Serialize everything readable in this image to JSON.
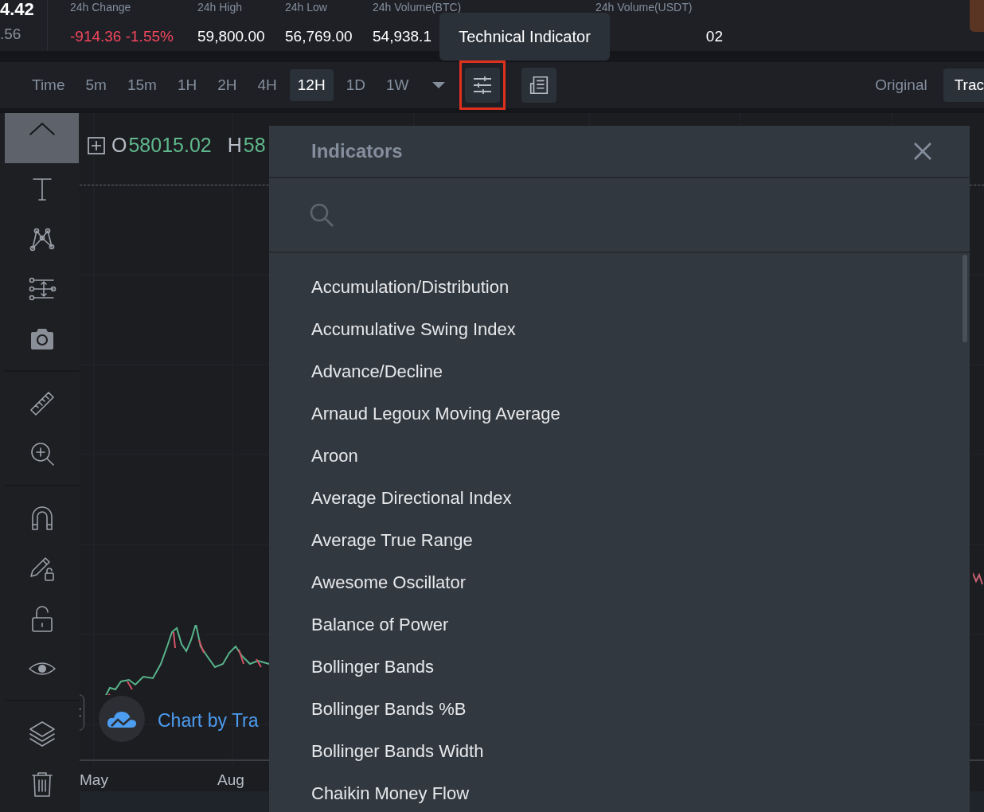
{
  "ticker": {
    "price": "4.42",
    "sub_price": ".56"
  },
  "stats": [
    {
      "label": "24h Change",
      "value": "-914.36 -1.55%",
      "color": "#f6465d"
    },
    {
      "label": "24h High",
      "value": "59,800.00",
      "color": "#ffffff"
    },
    {
      "label": "24h Low",
      "value": "56,769.00",
      "color": "#ffffff"
    },
    {
      "label": "24h Volume(BTC)",
      "value": "54,938.1",
      "color": "#ffffff"
    },
    {
      "label": "24h Volume(USDT)",
      "value": "02",
      "color": "#ffffff"
    }
  ],
  "tooltip": "Technical Indicator",
  "toolbar": {
    "intervals": [
      {
        "label": "Time",
        "selected": false
      },
      {
        "label": "5m",
        "selected": false
      },
      {
        "label": "15m",
        "selected": false
      },
      {
        "label": "1H",
        "selected": false
      },
      {
        "label": "2H",
        "selected": false
      },
      {
        "label": "4H",
        "selected": false
      },
      {
        "label": "12H",
        "selected": true
      },
      {
        "label": "1D",
        "selected": false
      },
      {
        "label": "1W",
        "selected": false
      }
    ],
    "tool_buttons": [
      {
        "kind": "indicators",
        "highlighted": true
      },
      {
        "kind": "template",
        "highlighted": false
      }
    ],
    "views": [
      {
        "label": "Original",
        "selected": false
      },
      {
        "label": "Trac",
        "selected": true
      }
    ]
  },
  "tools": [
    {
      "kind": "collapse",
      "selected": true
    },
    {
      "kind": "text",
      "selected": false
    },
    {
      "kind": "pattern",
      "selected": false
    },
    {
      "kind": "levels",
      "selected": false
    },
    {
      "kind": "camera",
      "selected": false
    },
    {
      "kind": "ruler",
      "selected": false
    },
    {
      "kind": "zoom",
      "selected": false
    },
    {
      "kind": "magnet",
      "selected": false
    },
    {
      "kind": "lock-drawing",
      "selected": false
    },
    {
      "kind": "unlock",
      "selected": false
    },
    {
      "kind": "eye",
      "selected": false
    },
    {
      "kind": "layers",
      "selected": false
    },
    {
      "kind": "trash",
      "selected": false
    }
  ],
  "legend": [
    {
      "key": "O",
      "value": "58015.02"
    },
    {
      "key": "H",
      "value": "58"
    }
  ],
  "axis": [
    "May",
    "Aug"
  ],
  "attribution": "Chart by Tra",
  "modal": {
    "title": "Indicators",
    "items": [
      "Accumulation/Distribution",
      "Accumulative Swing Index",
      "Advance/Decline",
      "Arnaud Legoux Moving Average",
      "Aroon",
      "Average Directional Index",
      "Average True Range",
      "Awesome Oscillator",
      "Balance of Power",
      "Bollinger Bands",
      "Bollinger Bands %B",
      "Bollinger Bands Width",
      "Chaikin Money Flow"
    ]
  }
}
